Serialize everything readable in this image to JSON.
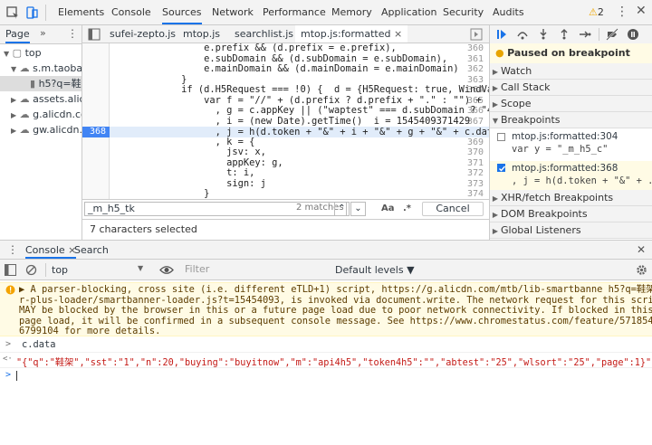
{
  "toolbar": {
    "tabs": [
      "Elements",
      "Console",
      "Sources",
      "Network",
      "Performance",
      "Memory",
      "Application",
      "Security",
      "Audits"
    ],
    "active_tab": "Sources",
    "warning_count": "2"
  },
  "navigator": {
    "tab_label": "Page",
    "more": "»",
    "tree": [
      "top",
      "s.m.taobao.",
      "h5?q=鞋架",
      "assets.alicd",
      "g.alicdn.cor",
      "gw.alicdn.co"
    ]
  },
  "editor": {
    "files": [
      "sufei-zepto.js",
      "mtop.js",
      "searchlist.js",
      "mtop.js:formatted"
    ],
    "active_file": "mtop.js:formatted",
    "lines": [
      {
        "n": "360",
        "text": "                e.prefix && (d.prefix = e.prefix),"
      },
      {
        "n": "361",
        "text": "                e.subDomain && (d.subDomain = e.subDomain),"
      },
      {
        "n": "362",
        "text": "                e.mainDomain && (d.mainDomain = e.mainDomain)"
      },
      {
        "n": "363",
        "text": "            }"
      },
      {
        "n": "364",
        "text": "            if (d.H5Request === !0) {  d = {H5Request: true, WindVaneRequest"
      },
      {
        "n": "365",
        "text": "                var f = \"//\" + (d.prefix ? d.prefix + \".\" : \"\") + (d.subDoma"
      },
      {
        "n": "366",
        "text": "                  , g = c.appKey || (\"waptest\" === d.subDomain ? \"4272\" : \"1"
      },
      {
        "n": "367",
        "text": "                  , i = (new Date).getTime()  i = 1545409371429"
      },
      {
        "n": "368",
        "text": "                  , j = h(d.token + \"&\" + i + \"&\" + g + \"&\" + c.data)"
      },
      {
        "n": "369",
        "text": "                  , k = {"
      },
      {
        "n": "370",
        "text": "                    jsv: x,"
      },
      {
        "n": "371",
        "text": "                    appKey: g,"
      },
      {
        "n": "372",
        "text": "                    t: i,"
      },
      {
        "n": "373",
        "text": "                    sign: j"
      },
      {
        "n": "374",
        "text": "                }"
      }
    ],
    "paused_line": "368",
    "search_value": "_m_h5_tk",
    "search_matches": "2 matches",
    "case_label": "Aa",
    "regex_label": ".*",
    "cancel_label": "Cancel",
    "status": "7 characters selected"
  },
  "sidebar": {
    "paused_label": "Paused on breakpoint",
    "sections": [
      "Watch",
      "Call Stack",
      "Scope",
      "Breakpoints",
      "XHR/fetch Breakpoints",
      "DOM Breakpoints",
      "Global Listeners"
    ],
    "breakpoints": [
      {
        "file": "mtop.js:formatted:304",
        "code": "var y = \"_m_h5_c\""
      },
      {
        "file": "mtop.js:formatted:368",
        "code": ", j = h(d.token + \"&\" + ..."
      }
    ]
  },
  "drawer": {
    "tabs": [
      "Console",
      "Search"
    ],
    "active_tab": "Console",
    "context": "top",
    "filter_placeholder": "Filter",
    "levels": "Default levels ▼",
    "warning": [
      "▶ A parser-blocking, cross site (i.e. different eTLD+1) script, https://g.alicdn.com/mtb/lib-smartbanne h5?q=鞋架:59",
      "r-plus-loader/smartbanner-loader.js?t=15454093, is invoked via document.write. The network request for this script",
      "MAY be blocked by the browser in this or a future page load due to poor network connectivity. If blocked in this",
      "page load, it will be confirmed in a subsequent console message. See https://www.chromestatus.com/feature/571854794",
      "6799104 for more details."
    ],
    "input_cmd": "c.data",
    "output": "\"{\"q\":\"鞋架\",\"sst\":\"1\",\"n\":20,\"buying\":\"buyitnow\",\"m\":\"api4h5\",\"token4h5\":\"\",\"abtest\":\"25\",\"wlsort\":\"25\",\"page\":1}\"",
    "prompt": ">",
    "result_prompt": "<·"
  },
  "colors": {
    "accent": "#1a73e8",
    "warning_bg": "#fffbe5",
    "exec_line": "#e1ecfa"
  }
}
